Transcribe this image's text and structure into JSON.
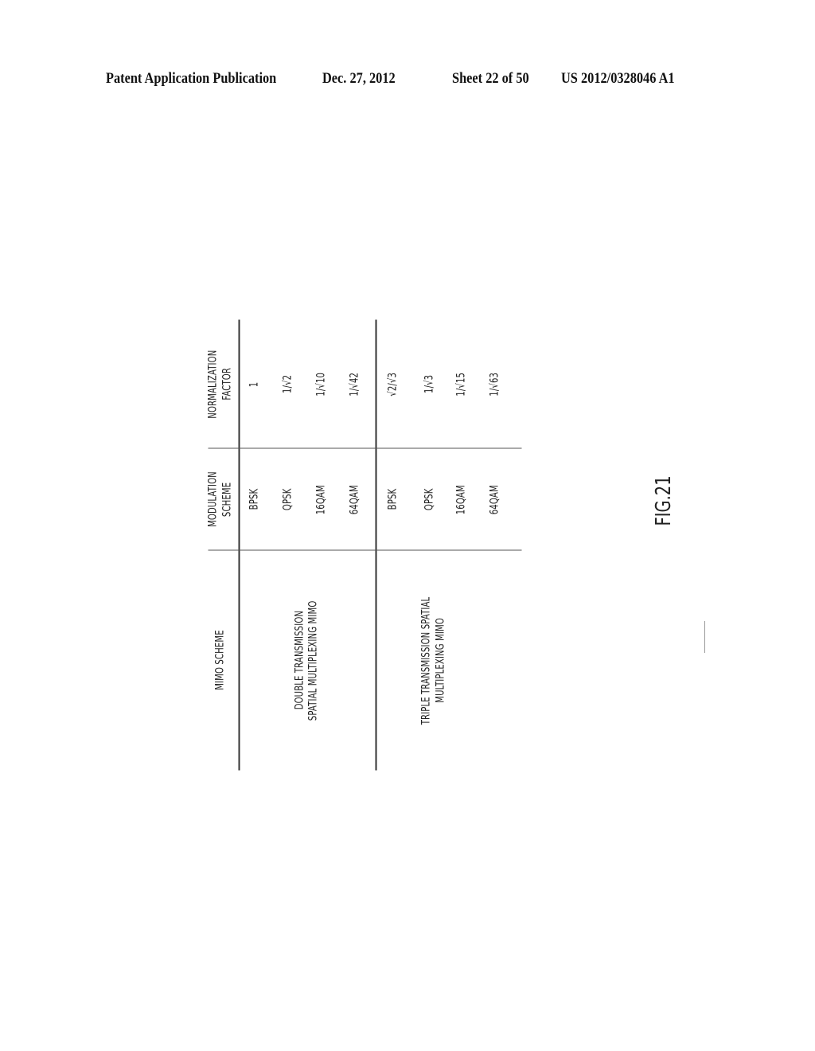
{
  "header": {
    "publication": "Patent Application Publication",
    "date": "Dec. 27, 2012",
    "sheet": "Sheet 22 of 50",
    "number": "US 2012/0328046 A1"
  },
  "table": {
    "columns": [
      "MIMO SCHEME",
      "MODULATION SCHEME",
      "NORMALIZATION FACTOR"
    ],
    "column_lines": {
      "mimo": [
        "MIMO SCHEME"
      ],
      "modulation": [
        "MODULATION",
        "SCHEME"
      ],
      "normalization": [
        "NORMALIZATION",
        "FACTOR"
      ]
    },
    "groups": [
      {
        "mimo_scheme": "DOUBLE TRANSMISSION SPATIAL MULTIPLEXING MIMO",
        "mimo_lines": [
          "DOUBLE TRANSMISSION",
          "SPATIAL MULTIPLEXING MIMO"
        ],
        "rows": [
          {
            "modulation": "BPSK",
            "factor": "1"
          },
          {
            "modulation": "QPSK",
            "factor": "1/√2"
          },
          {
            "modulation": "16QAM",
            "factor": "1/√10"
          },
          {
            "modulation": "64QAM",
            "factor": "1/√42"
          }
        ]
      },
      {
        "mimo_scheme": "TRIPLE TRANSMISSION SPATIAL MULTIPLEXING MIMO",
        "mimo_lines": [
          "TRIPLE TRANSMISSION SPATIAL",
          "MULTIPLEXING MIMO"
        ],
        "rows": [
          {
            "modulation": "BPSK",
            "factor": "√2/√3"
          },
          {
            "modulation": "QPSK",
            "factor": "1/√3"
          },
          {
            "modulation": "16QAM",
            "factor": "1/√15"
          },
          {
            "modulation": "64QAM",
            "factor": "1/√63"
          }
        ]
      }
    ]
  },
  "figure_label": "FIG.21"
}
